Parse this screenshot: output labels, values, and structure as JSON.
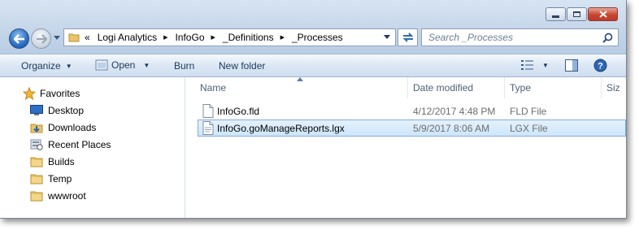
{
  "window": {
    "minimize_icon": "minimize-icon",
    "maximize_icon": "maximize-icon",
    "close_icon": "close-icon"
  },
  "addressbar": {
    "overflow": "«",
    "crumbs": [
      "Logi Analytics",
      "InfoGo",
      "_Definitions",
      "_Processes"
    ]
  },
  "search": {
    "placeholder": "Search _Processes"
  },
  "toolbar": {
    "organize": "Organize",
    "open": "Open",
    "burn": "Burn",
    "new_folder": "New folder"
  },
  "sidebar": {
    "favorites": "Favorites",
    "items": [
      {
        "label": "Desktop",
        "icon": "desktop-icon"
      },
      {
        "label": "Downloads",
        "icon": "downloads-icon"
      },
      {
        "label": "Recent Places",
        "icon": "recent-places-icon"
      },
      {
        "label": "Builds",
        "icon": "folder-icon"
      },
      {
        "label": "Temp",
        "icon": "folder-icon"
      },
      {
        "label": "wwwroot",
        "icon": "folder-icon"
      }
    ]
  },
  "columns": {
    "name": "Name",
    "date": "Date modified",
    "type": "Type",
    "size": "Siz"
  },
  "files": [
    {
      "name": "InfoGo.fld",
      "date": "4/12/2017 4:48 PM",
      "type": "FLD File",
      "selected": false
    },
    {
      "name": "InfoGo.goManageReports.lgx",
      "date": "5/9/2017 8:06 AM",
      "type": "LGX File",
      "selected": true
    }
  ],
  "colors": {
    "frame": "#c4d5e9",
    "selection": "#cde6fb",
    "selection_border": "#84acdd",
    "close_button": "#c8442f"
  }
}
